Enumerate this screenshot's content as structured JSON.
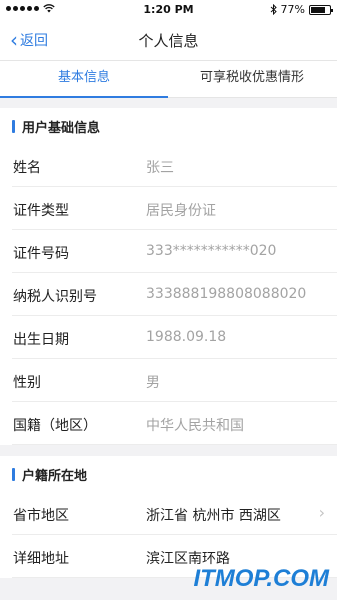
{
  "status_bar": {
    "time": "1:20 PM",
    "battery": "77%",
    "battery_level": 0.77,
    "wifi_icon": "wifi-icon",
    "bluetooth_icon": "bluetooth-icon"
  },
  "nav": {
    "back_label": "返回",
    "title": "个人信息"
  },
  "tabs": [
    {
      "label": "基本信息",
      "active": true
    },
    {
      "label": "可享税收优惠情形",
      "active": false
    }
  ],
  "sections": {
    "basic": {
      "title": "用户基础信息",
      "rows": [
        {
          "label": "姓名",
          "value": "张三"
        },
        {
          "label": "证件类型",
          "value": "居民身份证"
        },
        {
          "label": "证件号码",
          "value": "333***********020"
        },
        {
          "label": "纳税人识别号",
          "value": "333888198808088020"
        },
        {
          "label": "出生日期",
          "value": "1988.09.18"
        },
        {
          "label": "性别",
          "value": "男"
        },
        {
          "label": "国籍（地区）",
          "value": "中华人民共和国"
        }
      ]
    },
    "household": {
      "title": "户籍所在地",
      "rows": [
        {
          "label": "省市地区",
          "value": "浙江省 杭州市 西湖区"
        },
        {
          "label": "详细地址",
          "value": "滨江区南环路"
        }
      ]
    }
  },
  "watermark": "ITMOP.COM",
  "colors": {
    "accent": "#2f7ce0",
    "background": "#f2f2f4",
    "value_gray": "#a3a3a3"
  }
}
